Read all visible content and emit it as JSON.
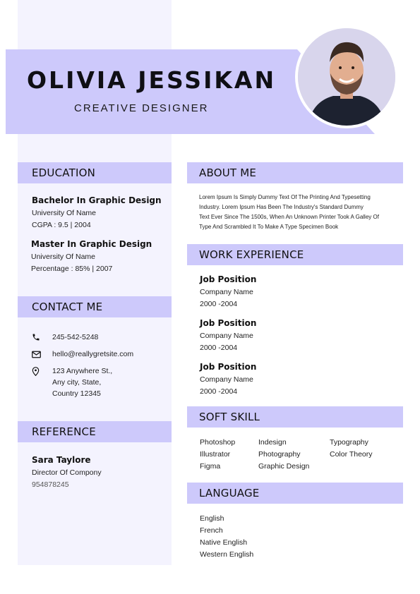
{
  "header": {
    "name": "OLIVIA JESSIKAN",
    "role": "CREATIVE DESIGNER"
  },
  "education": {
    "title": "EDUCATION",
    "items": [
      {
        "degree": "Bachelor In Graphic Design",
        "school": "University Of Name",
        "detail": "CGPA : 9.5 | 2004"
      },
      {
        "degree": "Master In Graphic Design",
        "school": "University Of Name",
        "detail": "Percentage : 85% | 2007"
      }
    ]
  },
  "contact": {
    "title": "CONTACT ME",
    "phone": "245-542-5248",
    "email": "hello@reallygretsite.com",
    "address_lines": [
      "123 Anywhere St.,",
      "Any city, State,",
      "Country 12345"
    ]
  },
  "reference": {
    "title": "REFERENCE",
    "name": "Sara Taylore",
    "position": "Director Of Compony",
    "phone": "954878245"
  },
  "about": {
    "title": "ABOUT ME",
    "lines": [
      "Lorem Ipsum Is Simply Dummy Text Of The Printing And Typesetting",
      "Industry. Lorem Ipsum Has Been The Industry's Standard Dummy",
      "Text Ever  Since The 1500s, When An Unknown Printer Took A Galley Of",
      "Type And Scrambled It To Make A Type Specimen Book"
    ]
  },
  "work": {
    "title": "WORK EXPERIENCE",
    "items": [
      {
        "position": "Job Position",
        "company": "Company Name",
        "years": "2000 -2004"
      },
      {
        "position": "Job Position",
        "company": "Company Name",
        "years": "2000 -2004"
      },
      {
        "position": "Job Position",
        "company": "Company Name",
        "years": "2000 -2004"
      }
    ]
  },
  "skills": {
    "title": "SOFT SKILL",
    "col1": [
      "Photoshop",
      "Illustrator",
      "Figma"
    ],
    "col2": [
      "Indesign",
      "Photography",
      "Graphic Design"
    ],
    "col3": [
      "Typography",
      "Color Theory"
    ]
  },
  "language": {
    "title": "LANGUAGE",
    "items": [
      "English",
      "French",
      "Native English",
      "Western English"
    ]
  },
  "colors": {
    "accent": "#cdc9fb",
    "sidebar": "#f4f3fe",
    "text": "#111111"
  },
  "icons": [
    "phone-icon",
    "mail-icon",
    "location-pin-icon"
  ]
}
